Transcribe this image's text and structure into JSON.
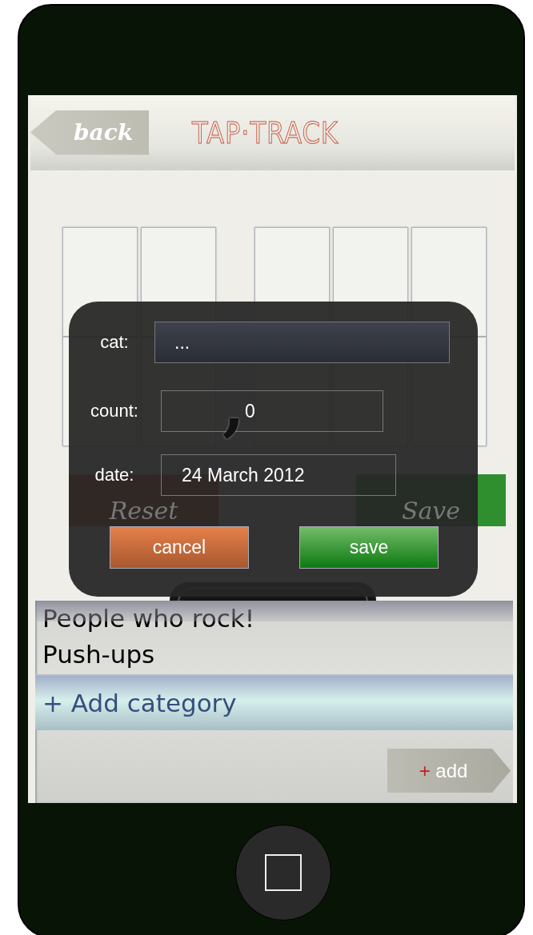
{
  "app": {
    "back_label": "back",
    "title": "TAP·TRACK"
  },
  "counter": {
    "separator": ","
  },
  "actions": [
    {
      "label": "Reset",
      "kind": "reset"
    },
    {
      "label": "Save",
      "kind": "save"
    }
  ],
  "dialog": {
    "fields": [
      {
        "label": "cat:",
        "value": "..."
      },
      {
        "label": "count:",
        "value": "0"
      },
      {
        "label": "date:",
        "value": "24 March 2012"
      }
    ],
    "buttons": [
      {
        "label": "cancel",
        "kind": "cancel"
      },
      {
        "label": "save",
        "kind": "confirm"
      }
    ]
  },
  "category_list": {
    "items": [
      {
        "label": "People who rock!",
        "selected": false
      },
      {
        "label": "Push-ups",
        "selected": false
      },
      {
        "label": "+ Add category",
        "selected": true
      }
    ]
  },
  "add_button": {
    "icon": "+",
    "label": "add"
  }
}
